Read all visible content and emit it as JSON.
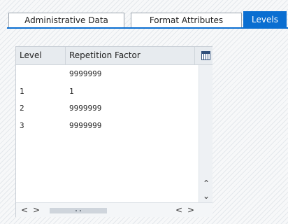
{
  "tabs": [
    {
      "label": "Administrative Data",
      "active": false
    },
    {
      "label": "Format Attributes",
      "active": false
    },
    {
      "label": "Levels",
      "active": true
    }
  ],
  "grid": {
    "columns": {
      "level": "Level",
      "repetition": "Repetition Factor"
    },
    "rows": [
      {
        "level": "",
        "repetition": "9999999"
      },
      {
        "level": "1",
        "repetition": "1"
      },
      {
        "level": "2",
        "repetition": "9999999"
      },
      {
        "level": "3",
        "repetition": "9999999"
      }
    ]
  },
  "scroll": {
    "up": "⌃",
    "down": "⌄",
    "left": "<",
    "right": ">"
  },
  "icons": {
    "settings": "table-settings-icon"
  },
  "colors": {
    "accent": "#0a6ed1",
    "header_bg": "#e7ebef"
  }
}
